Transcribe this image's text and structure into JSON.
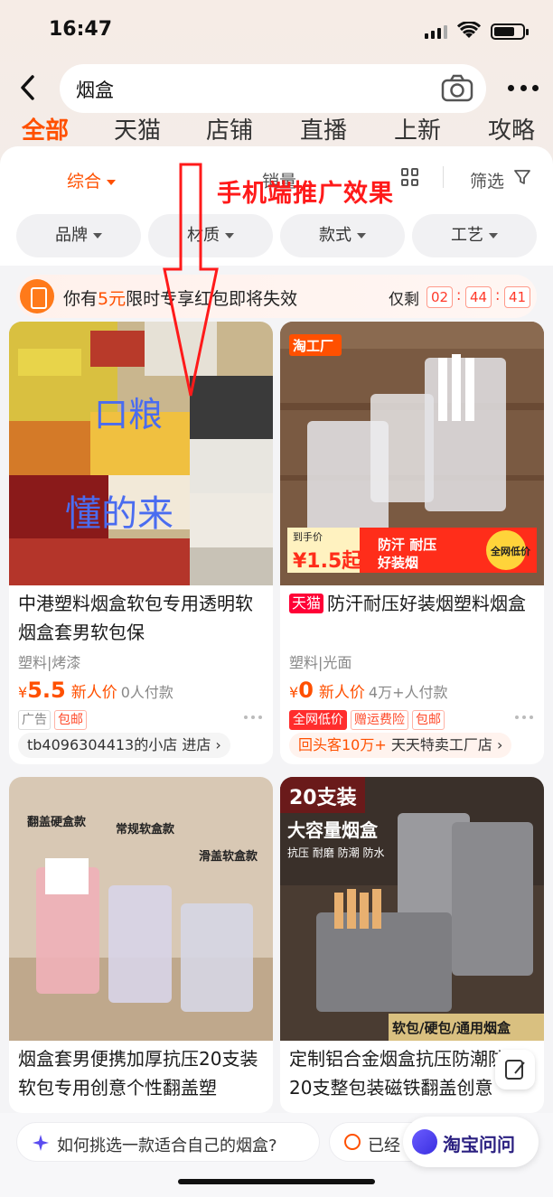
{
  "status": {
    "time": "16:47"
  },
  "search": {
    "query": "烟盒"
  },
  "top_tabs": [
    "全部",
    "天猫",
    "店铺",
    "直播",
    "上新",
    "攻略"
  ],
  "sort": {
    "comprehensive": "综合",
    "sales": "销量",
    "filter": "筛选"
  },
  "filter_chips": [
    "品牌",
    "材质",
    "款式",
    "工艺"
  ],
  "coupon": {
    "prefix": "你有",
    "amount": "5元",
    "suffix": "限时专享红包即将失效",
    "remain_label": "仅剩",
    "hh": "02",
    "mm": "44",
    "ss": "41"
  },
  "annotation": {
    "title": "手机端推广效果",
    "overlay_line1": "口粮",
    "overlay_line2": "懂的来"
  },
  "products": [
    {
      "title": "中港塑料烟盒软包专用透明软烟盒套男软包保",
      "attrs": "塑料|烤漆",
      "price_symbol": "¥",
      "price": "5.5",
      "price_tag": "新人价",
      "sold": "0人付款",
      "tags": [
        "广告",
        "包邮"
      ],
      "shop": "tb4096304413的小店 进店"
    },
    {
      "badge": "天猫",
      "title": "防汗耐压好装烟塑料烟盒",
      "attrs": "塑料|光面",
      "price_symbol": "¥",
      "price": "0",
      "price_tag": "新人价",
      "sold": "4万+人付款",
      "tags": [
        "全网低价",
        "赠运费险",
        "包邮"
      ],
      "shop_hl": "回头客10万+",
      "shop": "天天特卖工厂店",
      "img_badge": "淘工厂",
      "img_price_label": "到手价",
      "img_price": "¥1.5起",
      "img_slogan1": "防汗 耐压",
      "img_slogan2": "好装烟",
      "img_stamp": "全网低价"
    },
    {
      "title": "烟盒套男便携加厚抗压20支装软包专用创意个性翻盖塑",
      "img_label1": "翻盖硬盒款",
      "img_label2": "常规软盒款",
      "img_label3": "滑盖软盒款"
    },
    {
      "title": "定制铝合金烟盒抗压防潮防汗20支整包装磁铁翻盖创意",
      "img_top": "20支装",
      "img_title": "大容量烟盒",
      "img_sub": "抗压 耐磨 防潮 防水",
      "img_bottom": "软包/硬包/通用烟盒"
    }
  ],
  "bottom": {
    "ask_text": "如何挑选一款适合自己的烟盒?",
    "ask2_text": "已经",
    "taobao_ask": "淘宝问问"
  }
}
